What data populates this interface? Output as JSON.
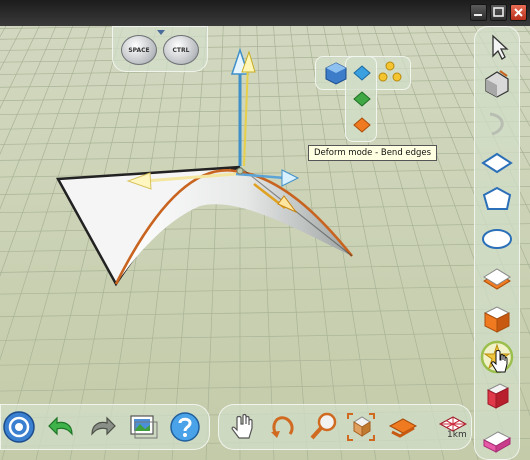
{
  "window": {
    "controls": [
      "minimize-icon",
      "maximize-icon",
      "close-icon"
    ]
  },
  "keys": {
    "space_label": "SPACE",
    "ctrl_label": "CTRL"
  },
  "tooltip": {
    "text": "Deform mode - Bend edges"
  },
  "right_toolbar": {
    "items": [
      "select-arrow-icon",
      "paint-bucket-icon",
      "bend-arrow-icon",
      "rhombus-shape-icon",
      "pentagon-shape-icon",
      "ellipse-shape-icon",
      "extrude-shape-icon",
      "cube-icon",
      "star-burst-icon",
      "eraser-icon"
    ]
  },
  "bottom_toolbar": {
    "items": [
      "app-menu-icon",
      "undo-icon",
      "redo-icon",
      "import-image-icon",
      "help-icon",
      "pan-hand-icon",
      "orbit-icon",
      "zoom-icon",
      "view-cube-icon",
      "snap-icon",
      "grid-scale-icon"
    ]
  },
  "grid_scale": {
    "label": "1km"
  },
  "colors": {
    "ground": "#c8d0b2",
    "grid_line": "#a9b396",
    "toolbar_pill": "#d3dcc8",
    "tooltip_bg": "#ffffe1"
  }
}
